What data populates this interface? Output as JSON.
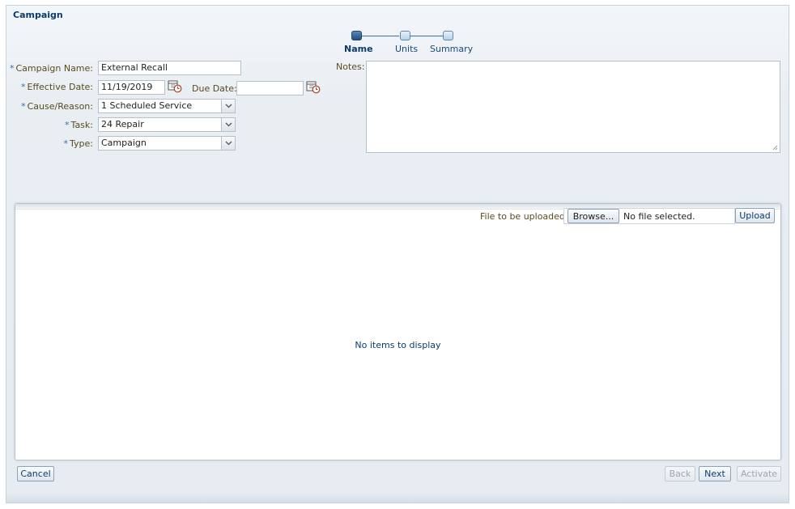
{
  "panel": {
    "title": "Campaign"
  },
  "train": {
    "steps": [
      {
        "label": "Name",
        "active": true
      },
      {
        "label": "Units",
        "active": false
      },
      {
        "label": "Summary",
        "active": false
      }
    ]
  },
  "form": {
    "required_marker": "*",
    "campaign_name": {
      "label": "Campaign Name:",
      "value": "External Recall"
    },
    "effective_date": {
      "label": "Effective Date:",
      "value": "11/19/2019"
    },
    "due_date": {
      "label": "Due Date:",
      "value": ""
    },
    "cause_reason": {
      "label": "Cause/Reason:",
      "value": "1 Scheduled Service"
    },
    "task": {
      "label": "Task:",
      "value": "24 Repair"
    },
    "type": {
      "label": "Type:",
      "value": "Campaign"
    },
    "notes": {
      "label": "Notes:",
      "value": ""
    }
  },
  "upload": {
    "label": "File to be uploaded:",
    "browse_label": "Browse...",
    "file_status": "No file selected.",
    "upload_label": "Upload"
  },
  "table": {
    "empty_text": "No items to display"
  },
  "footer": {
    "cancel_label": "Cancel",
    "back_label": "Back",
    "next_label": "Next",
    "activate_label": "Activate"
  },
  "icons": {
    "calendar": "calendar-icon",
    "dropdown": "chevron-down-icon",
    "resize": "resize-grip-icon"
  }
}
